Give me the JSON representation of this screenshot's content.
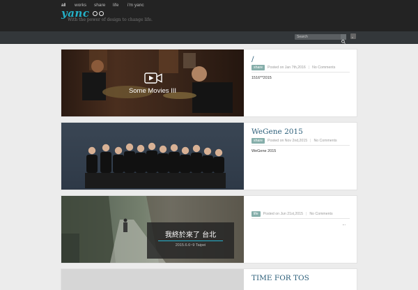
{
  "brand": {
    "name": "yanc",
    "tagline": "With the power of design to change life."
  },
  "nav": {
    "items": [
      {
        "label": "all"
      },
      {
        "label": "works"
      },
      {
        "label": "share"
      },
      {
        "label": "life"
      },
      {
        "label": "i'm yanc"
      }
    ]
  },
  "search": {
    "placeholder": "Search",
    "value": "Search"
  },
  "posts": [
    {
      "title": "/",
      "overlay_title": "Some Movies III",
      "overlay_subtitle": "",
      "tag": "share",
      "date": "Posted on Jan 7th,2016",
      "comments": "No Comments",
      "excerpt": "1516**2015"
    },
    {
      "title": "WeGene 2015",
      "tag": "share",
      "date": "Posted on Nov 2nd,2015",
      "comments": "No Comments",
      "excerpt": "WeGene 2015"
    },
    {
      "title": "",
      "overlay_title": "我終於來了 台北",
      "overlay_subtitle": "2015.6.6~9 Taipei",
      "tag": "life",
      "date": "Posted on Jun 21st,2015",
      "comments": "No Comments",
      "excerpt": "..."
    },
    {
      "title": "TIME FOR TOS"
    }
  ]
}
